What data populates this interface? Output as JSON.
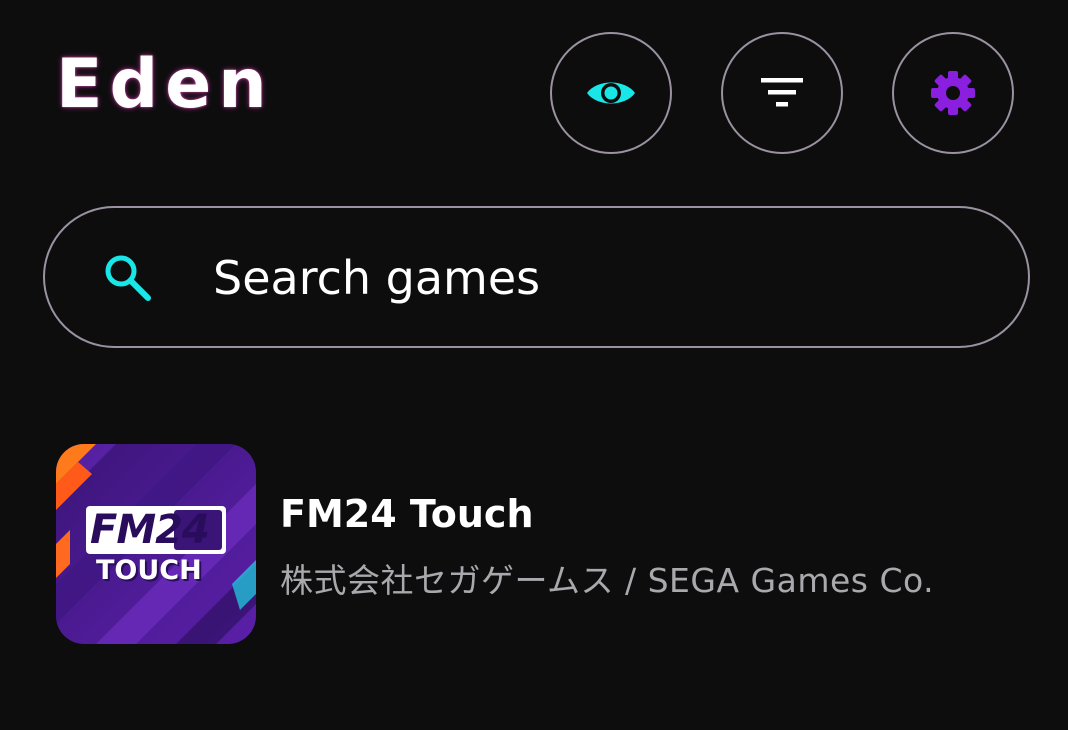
{
  "header": {
    "title": "Eden"
  },
  "toolbar": {
    "visibility_icon": "eye-icon",
    "filter_icon": "filter-icon",
    "settings_icon": "gear-icon"
  },
  "search": {
    "placeholder": "Search games",
    "value": ""
  },
  "games": [
    {
      "title": "FM24 Touch",
      "developer": "株式会社セガゲームス / SEGA Games Co.",
      "icon_text_top": "FM24",
      "icon_text_bottom": "TOUCH"
    }
  ],
  "colors": {
    "background": "#0d0d0e",
    "accent_cyan": "#19e6e6",
    "accent_purple": "#8a1fe0",
    "outline": "#9a92a0",
    "secondary_text": "#a9a9ad"
  }
}
